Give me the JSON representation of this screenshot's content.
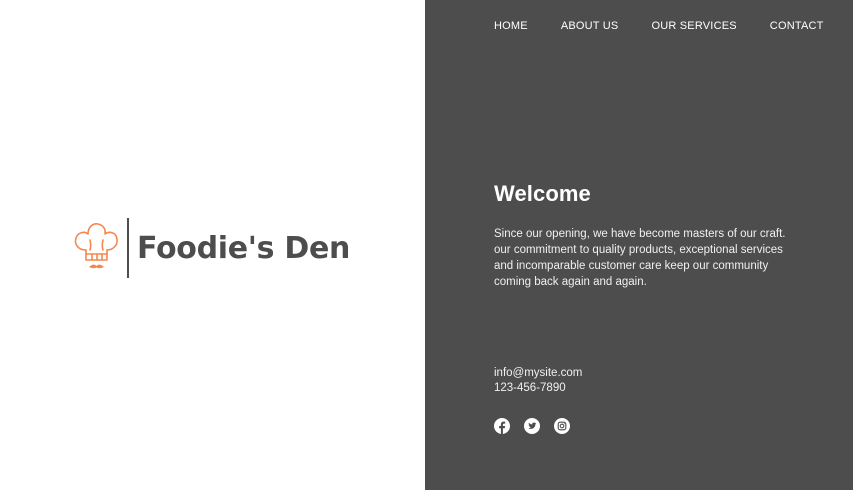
{
  "brand": {
    "name": "Foodie's Den",
    "logo_icon": "chef-hat-icon",
    "logo_icon_color": "#f4884f",
    "text_color": "#4d4d4d"
  },
  "nav": {
    "items": [
      {
        "label": "HOME"
      },
      {
        "label": "ABOUT US"
      },
      {
        "label": "OUR SERVICES"
      },
      {
        "label": "CONTACT"
      }
    ]
  },
  "main": {
    "title": "Welcome",
    "body": "Since our opening, we have become masters of our craft.\nour commitment to quality products, exceptional services\nand incomparable customer care keep our community\ncoming back again and again."
  },
  "contact": {
    "email": "info@mysite.com",
    "phone": "123-456-7890"
  },
  "social": [
    {
      "icon": "facebook-icon"
    },
    {
      "icon": "twitter-icon"
    },
    {
      "icon": "instagram-icon"
    }
  ],
  "colors": {
    "panel_background": "#4d4d4d",
    "panel_text": "#ffffff",
    "accent": "#f4884f"
  }
}
